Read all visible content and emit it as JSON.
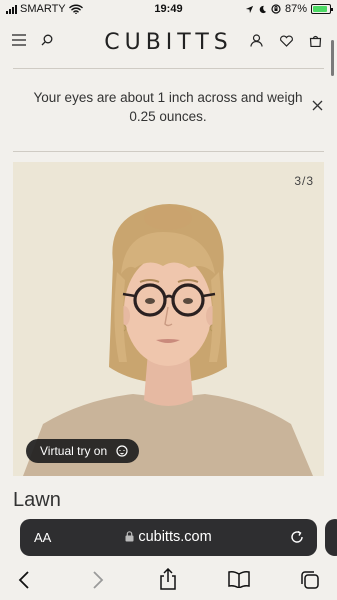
{
  "status_bar": {
    "carrier": "SMARTY",
    "time": "19:49",
    "battery": "87%",
    "battery_level": 0.87
  },
  "header": {
    "logo": "CUBITTS",
    "icons": [
      "menu-icon",
      "search-icon",
      "account-icon",
      "heart-icon",
      "bag-icon"
    ]
  },
  "announcement": {
    "text": "Your eyes are about 1 inch across and weigh 0.25 ounces."
  },
  "product": {
    "image_counter": "3/3",
    "virtual_try_on_label": "Virtual try on",
    "name": "Lawn"
  },
  "browser": {
    "text_size_label": "AA",
    "url": "cubitts.com",
    "accent": "#2e2e30"
  }
}
